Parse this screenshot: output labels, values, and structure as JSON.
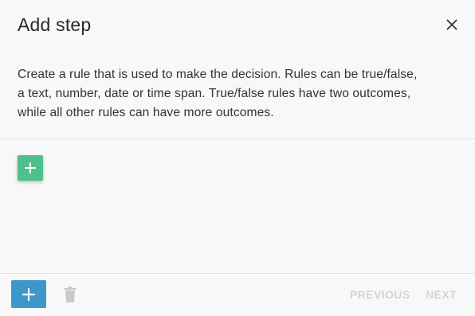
{
  "dialog": {
    "title": "Add step",
    "close_icon": "close-icon",
    "description_lines": [
      "Create a rule that is used to make the decision. Rules can be true/false,",
      "a text, number, date or time span. True/false rules have two outcomes,",
      "while all other rules can have more outcomes."
    ]
  },
  "rules": {
    "add_rule_icon": "plus-icon"
  },
  "footer": {
    "add_step_icon": "plus-icon",
    "delete_icon": "trash-icon",
    "previous_label": "PREVIOUS",
    "next_label": "NEXT"
  },
  "colors": {
    "add_rule_button": "#4fc08d",
    "add_step_button": "#3d97c8",
    "disabled_text": "#d4d4d4"
  }
}
